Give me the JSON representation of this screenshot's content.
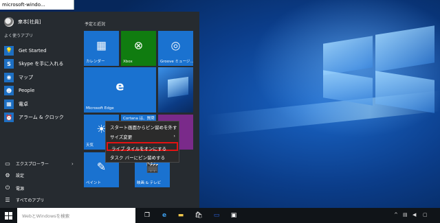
{
  "window": {
    "title": "microsoft-windo..."
  },
  "start_menu": {
    "user_name": "衆本[社員]",
    "most_used_label": "よく使うアプリ",
    "apps": [
      {
        "label": "Get Started",
        "icon": "lightbulb-icon"
      },
      {
        "label": "Skype を手に入れる",
        "icon": "skype-icon"
      },
      {
        "label": "マップ",
        "icon": "map-icon"
      },
      {
        "label": "People",
        "icon": "people-icon"
      },
      {
        "label": "電卓",
        "icon": "calculator-icon"
      },
      {
        "label": "アラーム & クロック",
        "icon": "alarm-icon"
      }
    ],
    "bottom": {
      "explorer_label": "エクスプローラー",
      "settings_label": "設定",
      "power_label": "電源",
      "all_apps_label": "すべてのアプリ"
    },
    "group_label": "予定と近況",
    "tiles": {
      "calendar": "カレンダー",
      "xbox": "Xbox",
      "groove": "Groove ミュージ...",
      "edge": "Microsoft Edge",
      "weather": "天気",
      "cortana": "Cortana は、質問や...",
      "paint": "ペイント",
      "movies": "映画 & テレビ"
    }
  },
  "context_menu": {
    "items": [
      {
        "label": "スタート画面からピン留めを外す"
      },
      {
        "label": "サイズ変更",
        "arrow": "›"
      },
      {
        "label": "ライブ タイルをオンにする",
        "highlighted": true
      },
      {
        "label": "タスク バーにピン留めする"
      }
    ]
  },
  "taskbar": {
    "search_placeholder": "WebとWindowsを検索"
  },
  "colors": {
    "tile_blue": "#1a72d0",
    "xbox_green": "#107c10",
    "onenote_purple": "#7a2a8a",
    "highlight_red": "#e51212"
  }
}
